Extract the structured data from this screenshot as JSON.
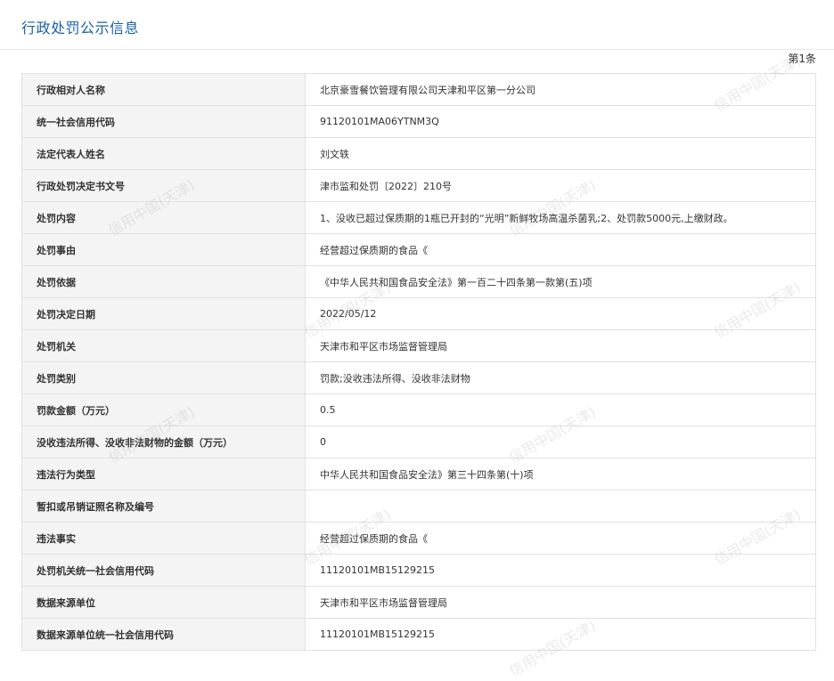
{
  "header": {
    "title": "行政处罚公示信息",
    "count": "第1条"
  },
  "watermark": "信用中国(天津)",
  "rows": [
    {
      "label": "行政相对人名称",
      "value": "北京豪雪餐饮管理有限公司天津和平区第一分公司"
    },
    {
      "label": "统一社会信用代码",
      "value": "91120101MA06YTNM3Q"
    },
    {
      "label": "法定代表人姓名",
      "value": "刘文轶"
    },
    {
      "label": "行政处罚决定书文号",
      "value": "津市监和处罚〔2022〕210号"
    },
    {
      "label": "处罚内容",
      "value": "1、没收已超过保质期的1瓶已开封的“光明”新鲜牧场高温杀菌乳;2、处罚款5000元,上缴财政。"
    },
    {
      "label": "处罚事由",
      "value": "经营超过保质期的食品《"
    },
    {
      "label": "处罚依据",
      "value": "《中华人民共和国食品安全法》第一百二十四条第一款第(五)项"
    },
    {
      "label": "处罚决定日期",
      "value": "2022/05/12"
    },
    {
      "label": "处罚机关",
      "value": "天津市和平区市场监督管理局"
    },
    {
      "label": "处罚类别",
      "value": "罚款;没收违法所得、没收非法财物"
    },
    {
      "label": "罚款金额（万元）",
      "value": "0.5"
    },
    {
      "label": "没收违法所得、没收非法财物的金额（万元）",
      "value": "0"
    },
    {
      "label": "违法行为类型",
      "value": "中华人民共和国食品安全法》第三十四条第(十)项"
    },
    {
      "label": "暂扣或吊销证照名称及编号",
      "value": ""
    },
    {
      "label": "违法事实",
      "value": "经营超过保质期的食品《"
    },
    {
      "label": "处罚机关统一社会信用代码",
      "value": "11120101MB15129215"
    },
    {
      "label": "数据来源单位",
      "value": "天津市和平区市场监督管理局"
    },
    {
      "label": "数据来源单位统一社会信用代码",
      "value": "11120101MB15129215"
    }
  ]
}
